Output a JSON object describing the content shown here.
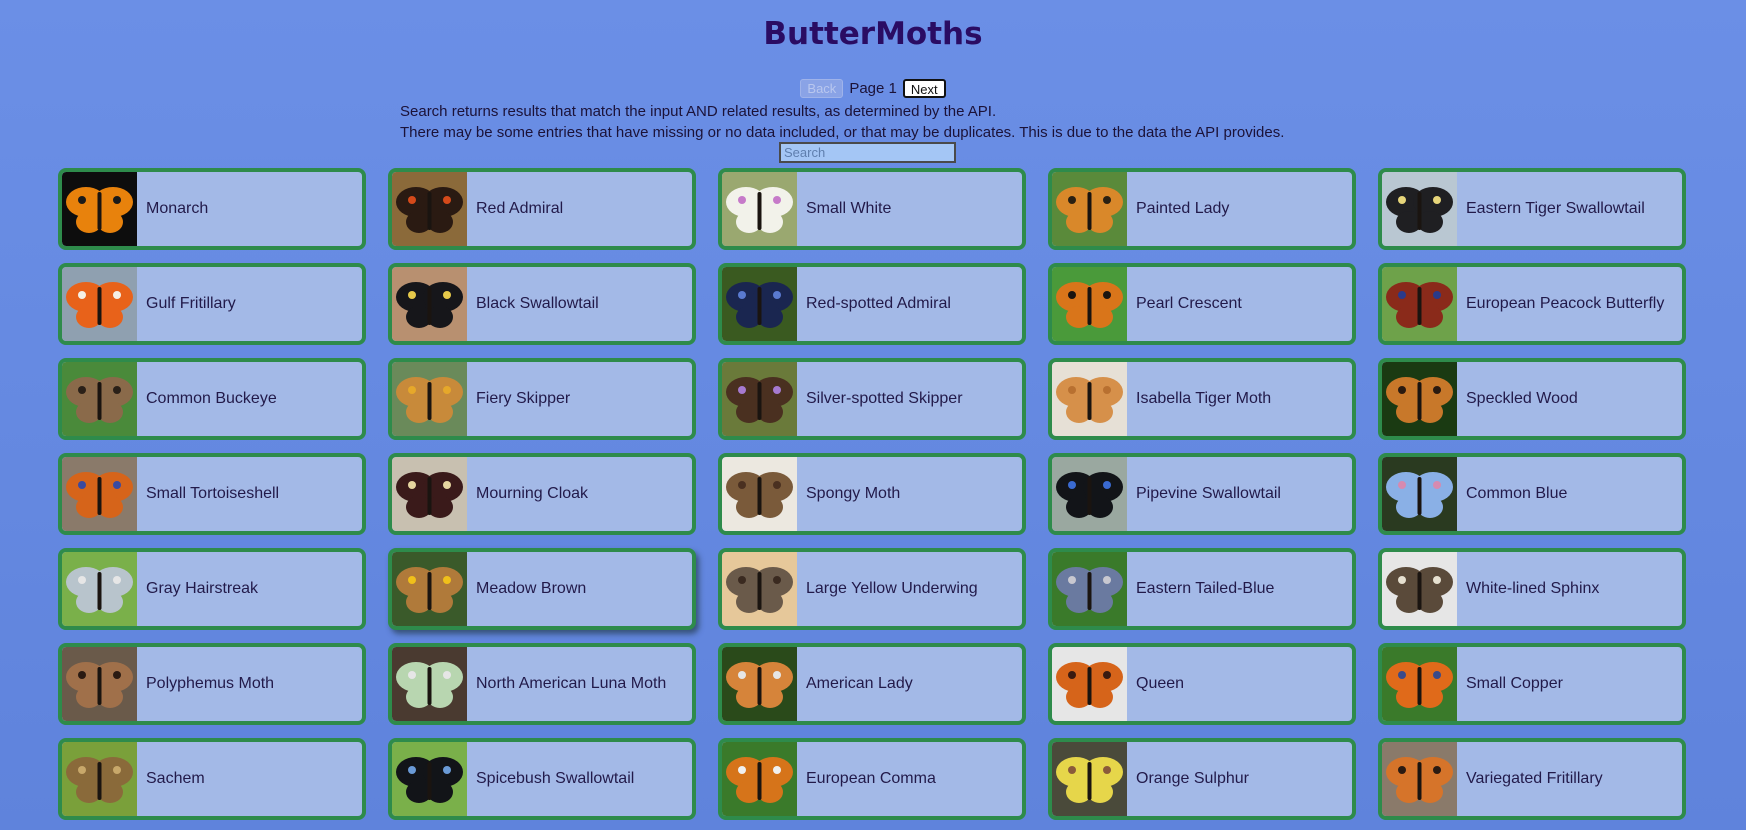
{
  "header": {
    "title": "ButterMoths"
  },
  "pager": {
    "back_label": "Back",
    "page_label": "Page 1",
    "next_label": "Next"
  },
  "notes": {
    "line1": "Search returns results that match the input AND related results, as determined by the API.",
    "line2": "There may be some entries that have missing or no data included, or that may be duplicates. This is due to the data the API provides."
  },
  "search": {
    "placeholder": "Search",
    "value": ""
  },
  "cards": [
    {
      "name": "Monarch",
      "bg": "#0d0d0d",
      "wing": "#e8820c",
      "accent": "#1a1a1a"
    },
    {
      "name": "Red Admiral",
      "bg": "#8b6a3a",
      "wing": "#2a1a12",
      "accent": "#d64a1a"
    },
    {
      "name": "Small White",
      "bg": "#9aa870",
      "wing": "#f2f2ea",
      "accent": "#c67ac9"
    },
    {
      "name": "Painted Lady",
      "bg": "#5a8a3a",
      "wing": "#d9882a",
      "accent": "#2a2012"
    },
    {
      "name": "Eastern Tiger Swallowtail",
      "bg": "#b9c7d2",
      "wing": "#1f1f22",
      "accent": "#e6d57a"
    },
    {
      "name": "Gulf Fritillary",
      "bg": "#8fa0b0",
      "wing": "#e8621a",
      "accent": "#f5f0e6"
    },
    {
      "name": "Black Swallowtail",
      "bg": "#b89070",
      "wing": "#16161a",
      "accent": "#e6c94a"
    },
    {
      "name": "Red-spotted Admiral",
      "bg": "#3a5a20",
      "wing": "#1a2650",
      "accent": "#5a7ad0"
    },
    {
      "name": "Pearl Crescent",
      "bg": "#4a9a3a",
      "wing": "#d9751a",
      "accent": "#1a1410"
    },
    {
      "name": "European Peacock Butterfly",
      "bg": "#6ea24a",
      "wing": "#8a2a1a",
      "accent": "#2a3a8a"
    },
    {
      "name": "Common Buckeye",
      "bg": "#4a8a3a",
      "wing": "#8a6a4a",
      "accent": "#2a2018"
    },
    {
      "name": "Fiery Skipper",
      "bg": "#6a8a5a",
      "wing": "#c88a3a",
      "accent": "#e6a82a"
    },
    {
      "name": "Silver-spotted Skipper",
      "bg": "#6a7a3a",
      "wing": "#4a3020",
      "accent": "#a67ad0"
    },
    {
      "name": "Isabella Tiger Moth",
      "bg": "#e6e0d6",
      "wing": "#d6904a",
      "accent": "#b87030"
    },
    {
      "name": "Speckled Wood",
      "bg": "#1a3a12",
      "wing": "#c8782a",
      "accent": "#2a1a10"
    },
    {
      "name": "Small Tortoiseshell",
      "bg": "#8a7a6a",
      "wing": "#d6641a",
      "accent": "#3a4aa0"
    },
    {
      "name": "Mourning Cloak",
      "bg": "#c8c0b0",
      "wing": "#3a1a1a",
      "accent": "#e6d6a0"
    },
    {
      "name": "Spongy Moth",
      "bg": "#ece8e0",
      "wing": "#7a5a3a",
      "accent": "#4a3020"
    },
    {
      "name": "Pipevine Swallowtail",
      "bg": "#9aa8a0",
      "wing": "#121418",
      "accent": "#3a6ad0"
    },
    {
      "name": "Common Blue",
      "bg": "#2a3a20",
      "wing": "#8ab0e6",
      "accent": "#d68ab0"
    },
    {
      "name": "Gray Hairstreak",
      "bg": "#7ab04a",
      "wing": "#b8c4cc",
      "accent": "#e6e6e6"
    },
    {
      "name": "Meadow Brown",
      "bg": "#3a5a2a",
      "wing": "#b07a3a",
      "accent": "#f0c01a"
    },
    {
      "name": "Large Yellow Underwing",
      "bg": "#e6c89a",
      "wing": "#6a5a4a",
      "accent": "#3a2a20"
    },
    {
      "name": "Eastern Tailed-Blue",
      "bg": "#3a7a2a",
      "wing": "#6a7aa0",
      "accent": "#c8c8d0"
    },
    {
      "name": "White-lined Sphinx",
      "bg": "#e6e6e6",
      "wing": "#5a4a3a",
      "accent": "#e6e0d0"
    },
    {
      "name": "Polyphemus Moth",
      "bg": "#6a5a4a",
      "wing": "#a0704a",
      "accent": "#2a1a12"
    },
    {
      "name": "North American Luna Moth",
      "bg": "#4a3a30",
      "wing": "#b8d6b0",
      "accent": "#e6e6e6"
    },
    {
      "name": "American Lady",
      "bg": "#2a4a1a",
      "wing": "#d6843a",
      "accent": "#e6e6e6"
    },
    {
      "name": "Queen",
      "bg": "#e6e6e6",
      "wing": "#d6641a",
      "accent": "#3a1a10"
    },
    {
      "name": "Small Copper",
      "bg": "#3a7a2a",
      "wing": "#e06a1a",
      "accent": "#3a4a8a"
    },
    {
      "name": "Sachem",
      "bg": "#7aa03a",
      "wing": "#8a6a3a",
      "accent": "#c8a86a"
    },
    {
      "name": "Spicebush Swallowtail",
      "bg": "#7ab04a",
      "wing": "#121418",
      "accent": "#6a9ad6"
    },
    {
      "name": "European Comma",
      "bg": "#3a7a2a",
      "wing": "#d6741a",
      "accent": "#f0f0f0"
    },
    {
      "name": "Orange Sulphur",
      "bg": "#4a4a3a",
      "wing": "#e6d64a",
      "accent": "#8a5a3a"
    },
    {
      "name": "Variegated Fritillary",
      "bg": "#8a7a6a",
      "wing": "#d6742a",
      "accent": "#2a1a12"
    }
  ]
}
